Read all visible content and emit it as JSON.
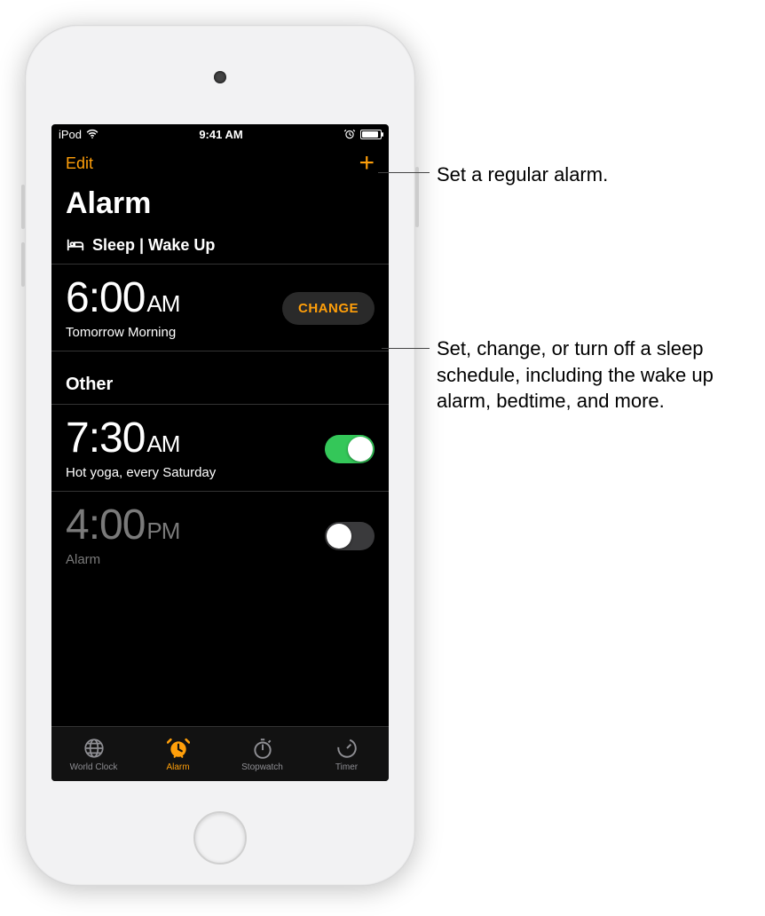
{
  "status_bar": {
    "carrier": "iPod",
    "time": "9:41 AM"
  },
  "nav": {
    "edit": "Edit",
    "add": "+"
  },
  "page_title": "Alarm",
  "sleep_section": {
    "header": "Sleep | Wake Up",
    "time": "6:00",
    "ampm": "AM",
    "subtitle": "Tomorrow Morning",
    "change": "CHANGE"
  },
  "other_section": {
    "header": "Other",
    "alarms": [
      {
        "time": "7:30",
        "ampm": "AM",
        "label": "Hot yoga, every Saturday",
        "on": true
      },
      {
        "time": "4:00",
        "ampm": "PM",
        "label": "Alarm",
        "on": false
      }
    ]
  },
  "tabs": [
    {
      "label": "World Clock"
    },
    {
      "label": "Alarm"
    },
    {
      "label": "Stopwatch"
    },
    {
      "label": "Timer"
    }
  ],
  "callouts": {
    "add": "Set a regular alarm.",
    "change": "Set, change, or turn off a sleep schedule, including the wake up alarm, bedtime, and more."
  }
}
